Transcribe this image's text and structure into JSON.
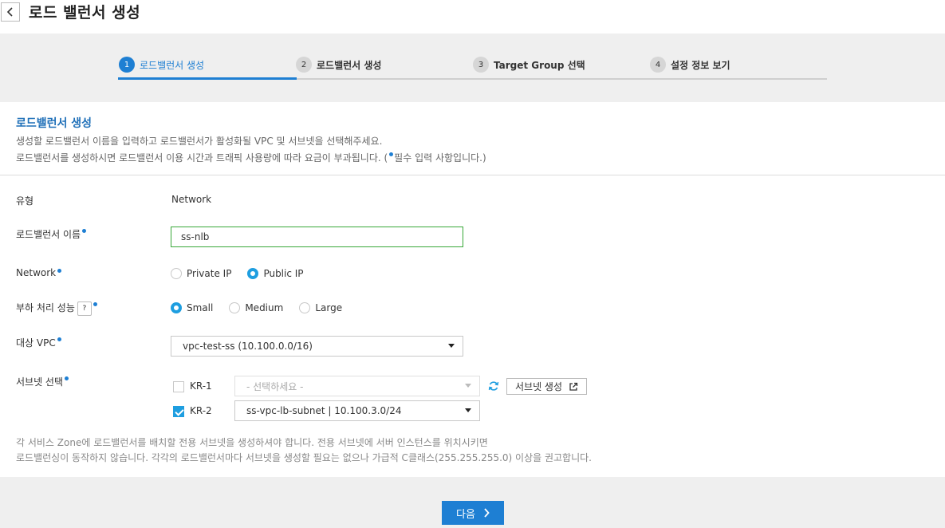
{
  "header": {
    "title": "로드 밸런서 생성"
  },
  "steps": [
    {
      "num": "1",
      "label": "로드밸런서 생성"
    },
    {
      "num": "2",
      "label": "로드밸런서 생성"
    },
    {
      "num": "3",
      "label": "Target Group 선택"
    },
    {
      "num": "4",
      "label": "설정 정보 보기"
    }
  ],
  "section": {
    "title": "로드밸런서 생성",
    "desc1": "생성할 로드밸런서 이름을 입력하고 로드밸런서가 활성화될 VPC 및 서브넷을 선택해주세요.",
    "desc2_prefix": "로드밸런서를 생성하시면 로드밸런서 이용 시간과 트래픽 사용량에 따라 요금이 부과됩니다. (",
    "desc2_suffix": "필수 입력 사항입니다.)"
  },
  "form": {
    "type_label": "유형",
    "type_value": "Network",
    "name_label": "로드밸런서 이름",
    "name_value": "ss-nlb",
    "network_label": "Network",
    "network_options": [
      "Private IP",
      "Public IP"
    ],
    "network_selected": "Public IP",
    "perf_label": "부하 처리 성능",
    "perf_help": "?",
    "perf_options": [
      "Small",
      "Medium",
      "Large"
    ],
    "perf_selected": "Small",
    "vpc_label": "대상 VPC",
    "vpc_value": "vpc-test-ss (10.100.0.0/16)",
    "subnet_label": "서브넷 선택",
    "subnets": [
      {
        "zone": "KR-1",
        "checked": false,
        "value": "- 선택하세요 -",
        "disabled": true
      },
      {
        "zone": "KR-2",
        "checked": true,
        "value": "ss-vpc-lb-subnet | 10.100.3.0/24",
        "disabled": false
      }
    ],
    "create_subnet_label": "서브넷 생성",
    "note1": "각 서비스 Zone에 로드밸런서를 배치할 전용 서브넷을 생성하셔야 합니다. 전용 서브넷에 서버 인스턴스를 위치시키면",
    "note2": "로드밸런싱이 동작하지 않습니다. 각각의 로드밸런서마다 서브넷을 생성할 필요는 없으나 가급적 C클래스(255.255.255.0) 이상을 권고합니다."
  },
  "footer": {
    "next_label": "다음"
  },
  "colors": {
    "accent": "#1e7fd3",
    "radio": "#1e9ee0",
    "input_border": "#38a838"
  }
}
